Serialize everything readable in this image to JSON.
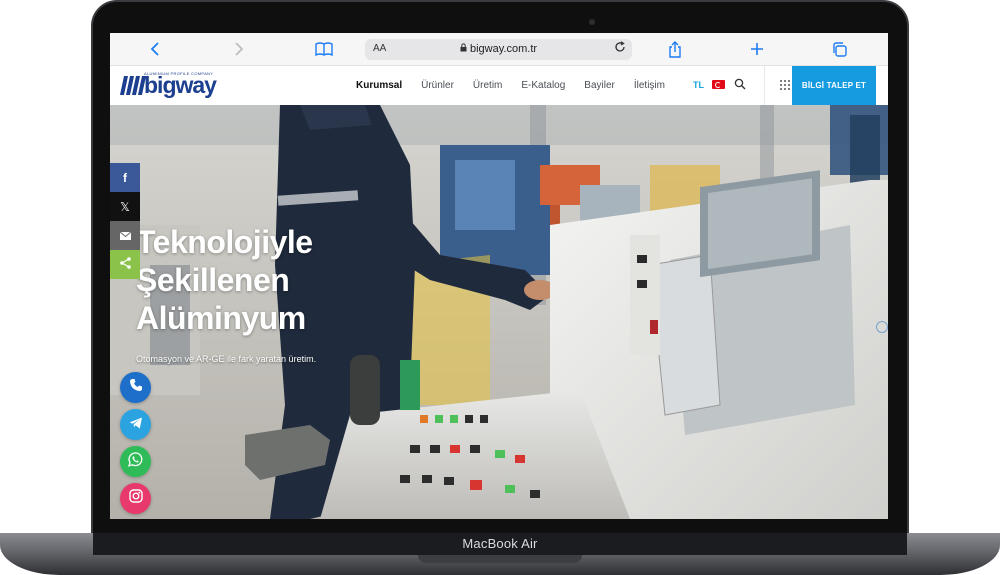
{
  "device": {
    "model_label": "MacBook Air"
  },
  "browser": {
    "url": "bigway.com.tr",
    "text_size_label": "AA",
    "icons": [
      "back-icon",
      "forward-icon",
      "bookmarks-icon",
      "lock-icon",
      "reload-icon",
      "share-icon",
      "new-tab-icon",
      "tabs-icon"
    ]
  },
  "site": {
    "logo": {
      "word": "bigway",
      "tagline": "ALUMINIUM PROFILE COMPANY"
    },
    "menu": [
      {
        "label": "Kurumsal",
        "active": true
      },
      {
        "label": "Ürünler",
        "active": false
      },
      {
        "label": "Üretim",
        "active": false
      },
      {
        "label": "E-Katalog",
        "active": false
      },
      {
        "label": "Bayiler",
        "active": false
      },
      {
        "label": "İletişim",
        "active": false
      }
    ],
    "lang_label": "TL",
    "cta_label": "BİLGİ TALEP ET",
    "colors": {
      "brand": "#1c3f8f",
      "accent": "#169be0"
    }
  },
  "hero": {
    "title_lines": [
      "Teknolojiyle",
      "Şekillenen",
      "Alüminyum"
    ],
    "subtitle": "Otomasyon ve AR-GE ile fark yaratan üretim."
  },
  "share_bar": [
    {
      "name": "facebook",
      "glyph": "f",
      "color": "#3b5998"
    },
    {
      "name": "x",
      "glyph": "𝕏",
      "color": "#111111"
    },
    {
      "name": "email",
      "glyph": "✉",
      "color": "#666666"
    },
    {
      "name": "share",
      "glyph": "<",
      "color": "#8bc34a"
    }
  ],
  "contact_buttons": [
    "phone-icon",
    "telegram-icon",
    "whatsapp-icon",
    "instagram-icon"
  ]
}
